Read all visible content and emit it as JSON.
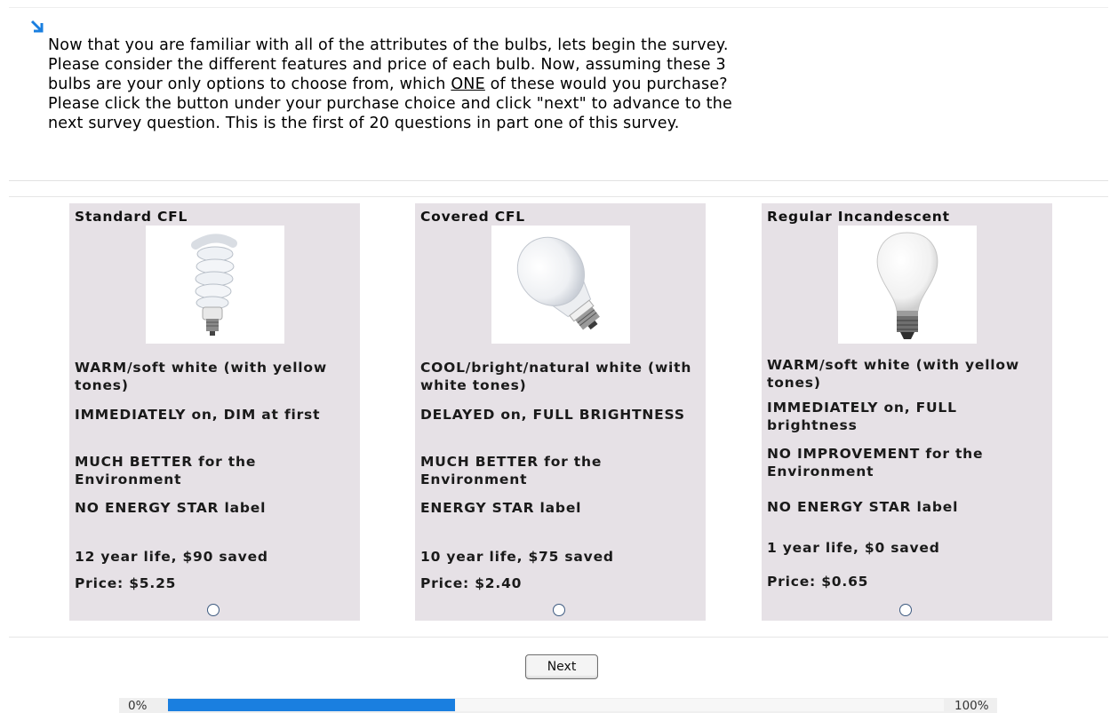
{
  "question": {
    "line1": "Now that you are familiar with all of the attributes of the bulbs, lets begin the survey.",
    "line2": "Please consider the different features and price of each bulb. Now, assuming these 3",
    "line3_before": "bulbs are your only options to choose from, which ",
    "line3_underlined": "ONE",
    "line3_after": " of these would you purchase?",
    "line4": "Please click the button under your purchase choice and click \"next\" to advance to the",
    "line5": "next survey question. This is the first of 20 questions in part one of this survey."
  },
  "options": [
    {
      "title": "Standard CFL",
      "image": "spiral-cfl-bulb",
      "color": "WARM/soft white (with yellow tones)",
      "startup": "IMMEDIATELY on, DIM at first",
      "environment": "MUCH BETTER for the Environment",
      "energy_star": "NO ENERGY STAR label",
      "life": "12 year life, $90 saved",
      "price": "Price: $5.25"
    },
    {
      "title": "Covered CFL",
      "image": "covered-cfl-bulb",
      "color": "COOL/bright/natural white (with white tones)",
      "startup": "DELAYED on, FULL BRIGHTNESS",
      "environment": "MUCH BETTER for the Environment",
      "energy_star": "ENERGY STAR label",
      "life": "10 year life, $75 saved",
      "price": "Price: $2.40"
    },
    {
      "title": "Regular Incandescent",
      "image": "incandescent-bulb",
      "color": "WARM/soft white (with yellow tones)",
      "startup": "IMMEDIATELY on, FULL brightness",
      "environment": "NO IMPROVEMENT for the Environment",
      "energy_star": "NO ENERGY STAR label",
      "life": "1 year life, $0 saved",
      "price": "Price: $0.65"
    }
  ],
  "next_label": "Next",
  "progress": {
    "start_label": "0%",
    "end_label": "100%",
    "fraction": 0.37
  },
  "colors": {
    "card_bg": "#e6e1e6",
    "progress_fill": "#1a7fe0",
    "arrow": "#1a7fe0"
  },
  "icons": {
    "arrow": "down-right-arrow-icon"
  }
}
